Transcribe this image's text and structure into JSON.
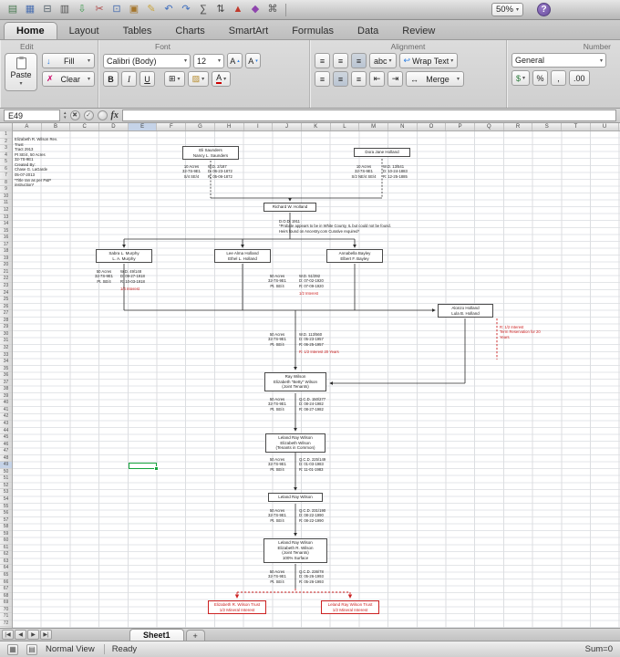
{
  "colors": {
    "selection_green": "#15a33c",
    "annotation_red": "#cc2222",
    "header_highlight": "#c5d3e8"
  },
  "toolbar": {
    "zoom": "50%",
    "help": "?",
    "icons": [
      {
        "name": "new-workbook-icon",
        "glyph": "▤",
        "color": "#4a7a52"
      },
      {
        "name": "open-icon",
        "glyph": "▦",
        "color": "#4a6fb0"
      },
      {
        "name": "save-icon",
        "glyph": "⊟",
        "color": "#57646e"
      },
      {
        "name": "print-icon",
        "glyph": "▥",
        "color": "#555555"
      },
      {
        "name": "import-icon",
        "glyph": "⇩",
        "color": "#3f9b4f"
      },
      {
        "name": "cut-icon",
        "glyph": "✂",
        "color": "#b04a4a"
      },
      {
        "name": "copy-icon",
        "glyph": "⊡",
        "color": "#4a6fb0"
      },
      {
        "name": "paste-icon",
        "glyph": "▣",
        "color": "#a5752c"
      },
      {
        "name": "format-painter-icon",
        "glyph": "✎",
        "color": "#caa53d"
      },
      {
        "name": "undo-icon",
        "glyph": "↶",
        "color": "#3f6fbf"
      },
      {
        "name": "redo-icon",
        "glyph": "↷",
        "color": "#3f6fbf"
      },
      {
        "name": "autosum-icon",
        "glyph": "∑",
        "color": "#444444"
      },
      {
        "name": "sort-icon",
        "glyph": "⇅",
        "color": "#444444"
      },
      {
        "name": "chart-icon",
        "glyph": "▲",
        "color": "#c0392b"
      },
      {
        "name": "gallery-icon",
        "glyph": "◆",
        "color": "#8e44ad"
      },
      {
        "name": "toolbox-icon",
        "glyph": "⌘",
        "color": "#555555"
      }
    ]
  },
  "ribbon": {
    "tabs": [
      "Home",
      "Layout",
      "Tables",
      "Charts",
      "SmartArt",
      "Formulas",
      "Data",
      "Review"
    ],
    "groups": {
      "edit": "Edit",
      "font": "Font",
      "alignment": "Alignment",
      "number": "Number"
    },
    "edit": {
      "paste": "Paste",
      "fill": "Fill",
      "clear": "Clear"
    },
    "font": {
      "family": "Calibri (Body)",
      "size": "12",
      "bold": "B",
      "italic": "I",
      "underline": "U"
    },
    "alignment": {
      "abc": "abc",
      "wrap": "Wrap Text",
      "merge": "Merge"
    },
    "number": {
      "format": "General"
    }
  },
  "glyphs": {
    "caret": "▾",
    "align": "≡",
    "wrap": "↩",
    "merge_icon": "↔",
    "border": "⊞",
    "bucket": "▨",
    "font_a": "A",
    "up": "▴",
    "down": "▾",
    "cancel": "✖",
    "accept": "✓",
    "dollar": "$",
    "percent": "%",
    "comma": ",",
    "decimals": ".00",
    "fill_arrow": "↓",
    "clear_x": "✗",
    "indent_l": "⇤",
    "indent_r": "⇥",
    "nav_first": "|◀",
    "nav_prev": "◀",
    "nav_next": "▶",
    "nav_last": "▶|"
  },
  "formula_bar": {
    "cell_ref": "E49",
    "fx": "fx"
  },
  "grid": {
    "columns": [
      "A",
      "B",
      "C",
      "D",
      "E",
      "F",
      "G",
      "H",
      "I",
      "J",
      "K",
      "L",
      "M",
      "N",
      "O",
      "P",
      "Q",
      "R",
      "S",
      "T",
      "U"
    ],
    "row_count": 72,
    "selected_column": "E",
    "selected_row": 49
  },
  "sheet_tabs": {
    "active": "Sheet1",
    "add": "+"
  },
  "status_bar": {
    "view": "Normal View",
    "state": "Ready",
    "sum": "Sum=0"
  },
  "diagram": {
    "info_block": "Elizabeth R. Wilson Rev.\nTrust\nTract 2913\nPt SE/4, 50 Acres\n32-7S-9E1\nCreated By:\nChase G. LaGarde\n05-07-2013\n*Title ran as per P&P\ninstruction*",
    "eli_box": "Eli Saunders\nNancy L. Saunders",
    "eli_legal": "10 Acres\n32-7S-9E1\nS/4 SE/4",
    "eli_deed": "W.D. 2/187\nD: 06-23-1872\nR: 05-06-1872",
    "dora_box": "Dora Jane Holland",
    "dora_legal": "10 Acres\n32-7S-9E1\nS/2 NE/4 SE/4",
    "dora_deed": "W.D. 13/541\nD: 10-24-1883\nR: 12-25-1885",
    "richard_box": "Richard W. Holland",
    "dod_note": "D.O.D. 1911\n*Probate appears to be in White County, IL but could not be found.\nHeirs found on Ancestry.com Curative required*",
    "sabra_box": "Sabra L. Murphy\nL. A. Murphy",
    "lee_box": "Lee Alma Holland\nEthel L. Holland",
    "annabella_box": "Annabella Bayley\nElbert F. Bayley",
    "sabra_legal": "50 Acres\n32-7S-9E1\nPt. SE/4",
    "sabra_deed": "W.D. 49/148\nD: 09-27-1918\nR: 10-03-1918",
    "sabra_interest": "1/4 Interest",
    "lee_legal": "50 Acres\n32-7S-9E1\nPt. SE/4",
    "lee_deed": "W.D. 51/392\nD: 07-02-1920\nR: 07-09-1920",
    "lee_interest": "1/2 Interest",
    "alonzo_box": "Alonzo Holland\nLula B. Holland",
    "term_note": "R: 1/2 Interest\nTerm Reservation for 20\nYears",
    "wd113_legal": "50 Acres\n32-7S-9E1\nPt. SE/4",
    "wd113_deed": "W.D. 113/560\nD: 05-23-1957\nR: 06-25-1957",
    "wd113_interest": "R: 1/2 Interest 20 Years",
    "ray_box": "Ray Wilson\nElizabeth \"Betty\" Wilson\n(Joint Tenants)",
    "qcd150_legal": "50 Acres\n32-7S-9E1\nPt. SE/4",
    "qcd150_deed": "Q.C.D. 150/277\nD: 08-24-1982\nR: 08-27-1982",
    "leland1_box": "Leland Ray Wilson\nElizabeth Wilson\n(Tenants in Common)",
    "qcd225_legal": "50 Acres\n32-7S-9E1\nPt. SE/4",
    "qcd225_deed": "Q.C.D. 225/149\nD: 01-03-1983\nR: 11-01-1983",
    "leland2_box": "Leland Ray Wilson",
    "qcd231_legal": "50 Acres\n32-7S-9E1\nPt. SE/4",
    "qcd231_deed": "Q.C.D. 231/190\nD: 08-22-1990\nR: 08-22-1990",
    "leland3_box": "Leland Ray Wilson\nElizabeth R. Wilson\n(Joint Tenants)\n100% Surface",
    "qcd236_legal": "50 Acres\n32-7S-9E1\nPt. SE/4",
    "qcd236_deed": "Q.C.D. 236/78\nD: 05-26-1993\nR: 05-26-1993",
    "trust1_box": "Elizabeth R. Wilson Trust\n1/2 Mineral Interest",
    "trust2_box": "Leland Ray Wilson Trust\n1/2 Mineral Interest"
  }
}
